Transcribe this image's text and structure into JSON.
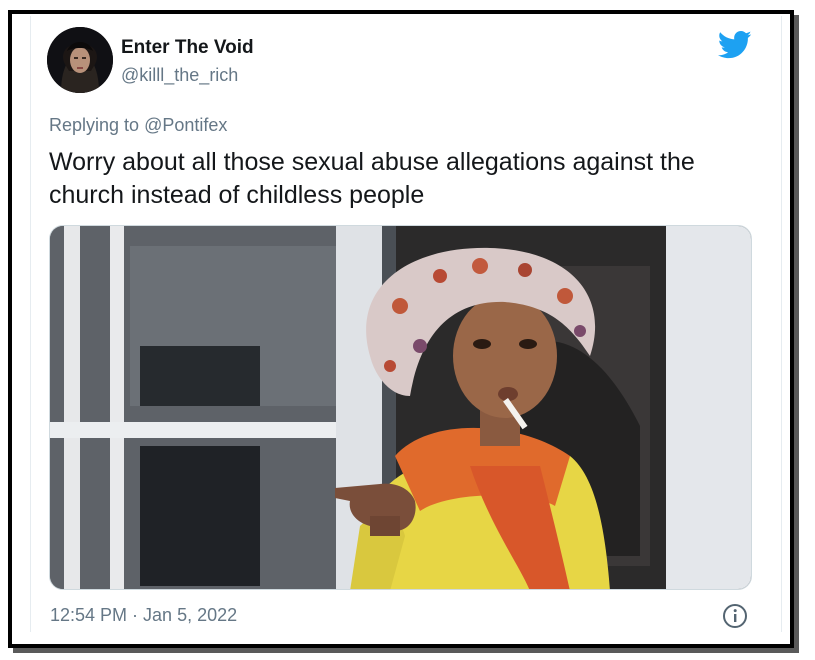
{
  "tweet": {
    "display_name": "Enter The Void",
    "handle": "@killl_the_rich",
    "replying_prefix": "Replying to",
    "reply_target": "@Pontifex",
    "text": "Worry about all those sexual abuse allegations against the church instead of childless people",
    "timestamp": "12:54 PM · Jan 5, 2022"
  },
  "icons": {
    "brand": "twitter-bird-icon",
    "info": "info-icon"
  },
  "colors": {
    "twitter_blue": "#1DA1F2",
    "secondary_text": "#657786",
    "primary_text": "#14171a"
  }
}
